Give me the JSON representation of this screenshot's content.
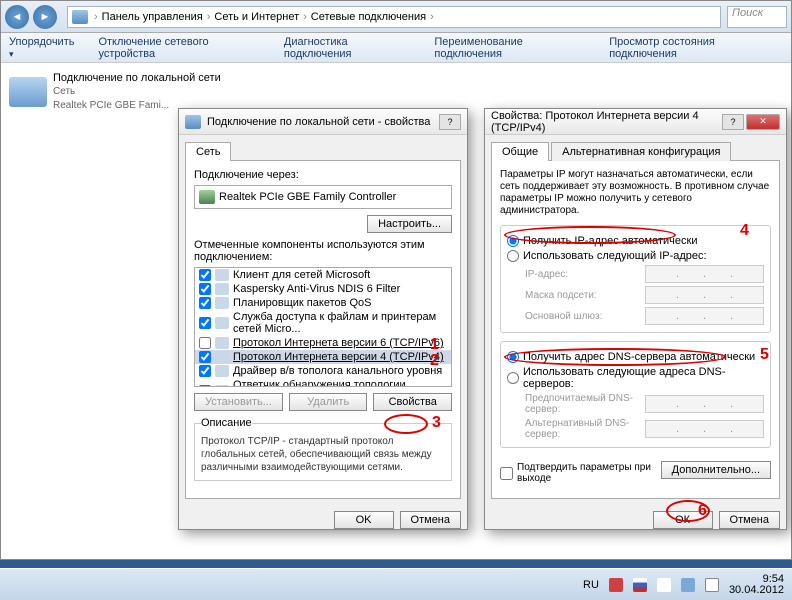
{
  "breadcrumb": {
    "p1": "Панель управления",
    "p2": "Сеть и Интернет",
    "p3": "Сетевые подключения"
  },
  "search_placeholder": "Поиск",
  "toolbar": {
    "organize": "Упорядочить",
    "disable": "Отключение сетевого устройства",
    "diagnose": "Диагностика подключения",
    "rename": "Переименование подключения",
    "status": "Просмотр состояния подключения"
  },
  "conn": {
    "name": "Подключение по локальной сети",
    "cat": "Сеть",
    "dev": "Realtek PCIe GBE Fami..."
  },
  "dlg1": {
    "title": "Подключение по локальной сети - свойства",
    "tab": "Сеть",
    "connect_via": "Подключение через:",
    "adapter": "Realtek PCIe GBE Family Controller",
    "configure": "Настроить...",
    "components_label": "Отмеченные компоненты используются этим подключением:",
    "items": [
      "Клиент для сетей Microsoft",
      "Kaspersky Anti-Virus NDIS 6 Filter",
      "Планировщик пакетов QoS",
      "Служба доступа к файлам и принтерам сетей Micro...",
      "Протокол Интернета версии 6 (TCP/IPv6)",
      "Протокол Интернета версии 4 (TCP/IPv4)",
      "Драйвер в/в тополога канального уровня",
      "Ответчик обнаружения топологии канального уровня"
    ],
    "install": "Установить...",
    "uninstall": "Удалить",
    "properties": "Свойства",
    "desc_h": "Описание",
    "desc": "Протокол TCP/IP - стандартный протокол глобальных сетей, обеспечивающий связь между различными взаимодействующими сетями.",
    "ok": "OK",
    "cancel": "Отмена"
  },
  "dlg2": {
    "title": "Свойства: Протокол Интернета версии 4 (TCP/IPv4)",
    "tab1": "Общие",
    "tab2": "Альтернативная конфигурация",
    "info": "Параметры IP могут назначаться автоматически, если сеть поддерживает эту возможность. В противном случае параметры IP можно получить у сетевого администратора.",
    "r_ip_auto": "Получить IP-адрес автоматически",
    "r_ip_manual": "Использовать следующий IP-адрес:",
    "ip_addr": "IP-адрес:",
    "mask": "Маска подсети:",
    "gw": "Основной шлюз:",
    "r_dns_auto": "Получить адрес DNS-сервера автоматически",
    "r_dns_manual": "Использовать следующие адреса DNS-серверов:",
    "dns1": "Предпочитаемый DNS-сервер:",
    "dns2": "Альтернативный DNS-сервер:",
    "validate": "Подтвердить параметры при выходе",
    "advanced": "Дополнительно...",
    "ok": "ОК",
    "cancel": "Отмена"
  },
  "annot": {
    "a1": "1",
    "a2": "2",
    "a3": "3",
    "a4": "4",
    "a5": "5",
    "a6": "6"
  },
  "tray": {
    "lang": "RU",
    "time": "9:54",
    "date": "30.04.2012"
  }
}
